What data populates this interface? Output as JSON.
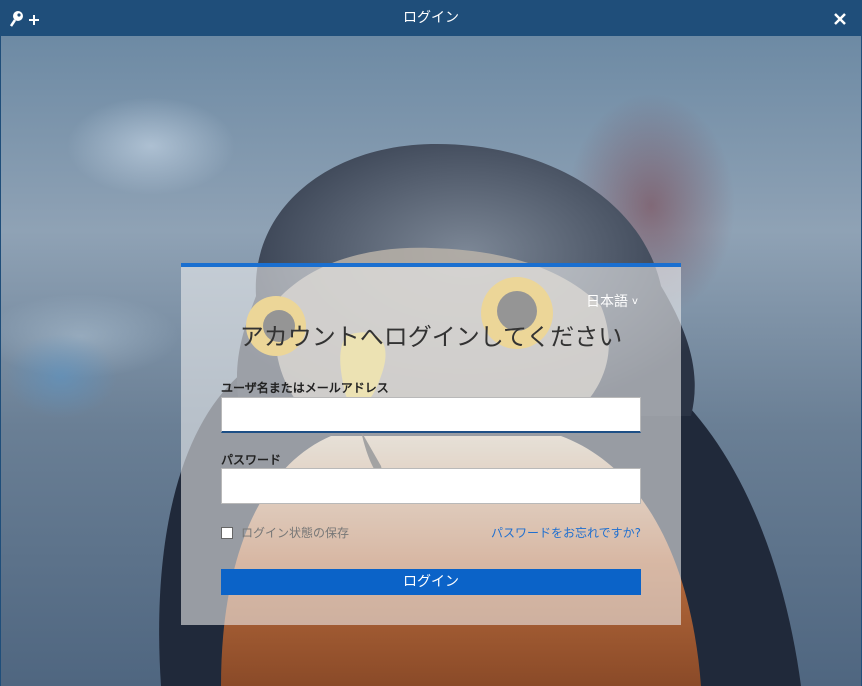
{
  "window": {
    "title": "ログイン",
    "key_icon": "key-plus-icon",
    "close_icon": "close-icon"
  },
  "login": {
    "language": "日本語",
    "language_chevron": "v",
    "heading": "アカウントへログインしてください",
    "username_label": "ユーザ名またはメールアドレス",
    "username_value": "",
    "password_label": "パスワード",
    "password_value": "",
    "remember_label": "ログイン状態の保存",
    "forgot_label": "パスワードをお忘れですか?",
    "submit_label": "ログイン"
  },
  "colors": {
    "titlebar": "#1f4e7a",
    "accent": "#0b63c8",
    "link": "#1f6fd0"
  }
}
